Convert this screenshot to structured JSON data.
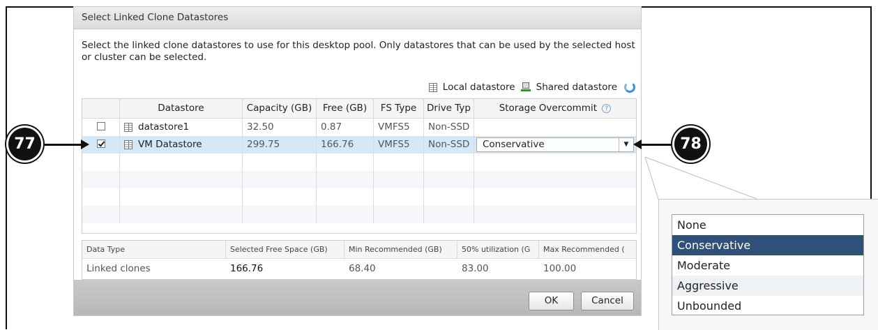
{
  "dialog": {
    "title": "Select Linked Clone Datastores",
    "description": "Select the linked clone datastores to use for this desktop pool. Only datastores that can be used by the selected host or cluster can be selected.",
    "legend_local": "Local datastore",
    "legend_shared": "Shared datastore"
  },
  "grid": {
    "headers": [
      "Datastore",
      "Capacity (GB)",
      "Free (GB)",
      "FS Type",
      "Drive Typ",
      "Storage Overcommit"
    ],
    "rows": [
      {
        "checked": false,
        "name": "datastore1",
        "capacity": "32.50",
        "free": "0.87",
        "fs": "VMFS5",
        "drive": "Non-SSD",
        "overcommit": ""
      },
      {
        "checked": true,
        "name": "VM Datastore",
        "capacity": "299.75",
        "free": "166.76",
        "fs": "VMFS5",
        "drive": "Non-SSD",
        "overcommit": "Conservative"
      }
    ]
  },
  "summary": {
    "headers": [
      "Data Type",
      "Selected Free Space (GB)",
      "Min Recommended (GB)",
      "50% utilization (G",
      "Max Recommended ("
    ],
    "row": [
      "Linked clones",
      "166.76",
      "68.40",
      "83.00",
      "100.00"
    ]
  },
  "buttons": {
    "ok": "OK",
    "cancel": "Cancel"
  },
  "callouts": {
    "left": "77",
    "right": "78"
  },
  "dropdown": {
    "options": [
      "None",
      "Conservative",
      "Moderate",
      "Aggressive",
      "Unbounded"
    ],
    "selected": "Conservative"
  },
  "icons": {
    "help": "?"
  }
}
